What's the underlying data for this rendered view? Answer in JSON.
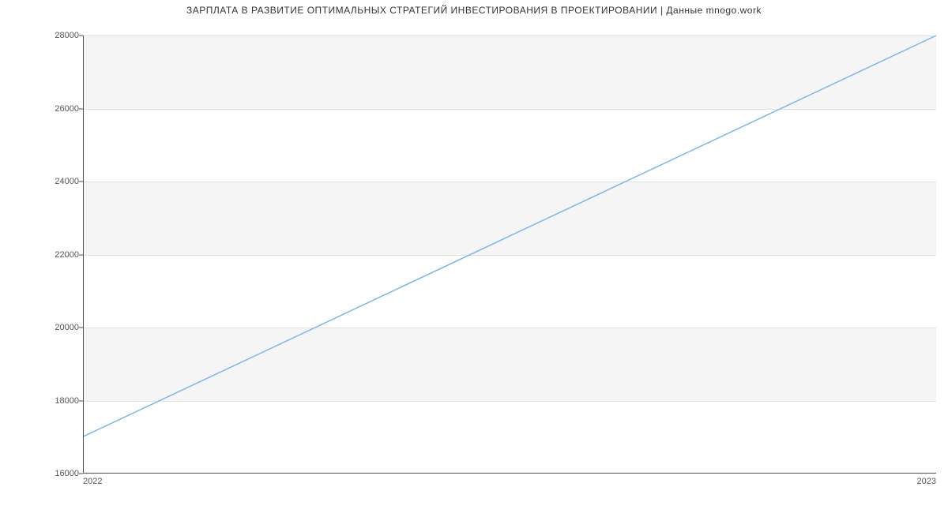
{
  "chart_data": {
    "type": "line",
    "title": "ЗАРПЛАТА В РАЗВИТИЕ ОПТИМАЛЬНЫХ СТРАТЕГИЙ ИНВЕСТИРОВАНИЯ В ПРОЕКТИРОВАНИИ | Данные mnogo.work",
    "xlabel": "",
    "ylabel": "",
    "x": [
      2022,
      2023
    ],
    "values": [
      17000,
      28000
    ],
    "x_ticks": [
      "2022",
      "2023"
    ],
    "y_ticks": [
      "16000",
      "18000",
      "20000",
      "22000",
      "24000",
      "26000",
      "28000"
    ],
    "ylim": [
      16000,
      28000
    ],
    "xlim": [
      2022,
      2023
    ]
  }
}
